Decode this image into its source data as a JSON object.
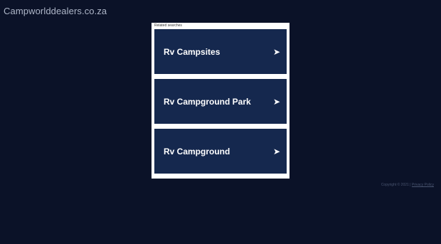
{
  "site": {
    "title": "Campworlddealers.co.za"
  },
  "related": {
    "header": "Related searches",
    "items": [
      {
        "label": "Rv Campsites",
        "arrow": "➤"
      },
      {
        "label": "Rv Campground Park",
        "arrow": "➤"
      },
      {
        "label": "Rv Campground",
        "arrow": "➤"
      }
    ]
  },
  "footer": {
    "copyright": "Copyright © 2021 | ",
    "privacy_label": "Privacy Policy"
  },
  "colors": {
    "background": "#0b1228",
    "panel": "#ffffff",
    "link_item": "#15284e",
    "title_text": "#aeb6c8"
  }
}
